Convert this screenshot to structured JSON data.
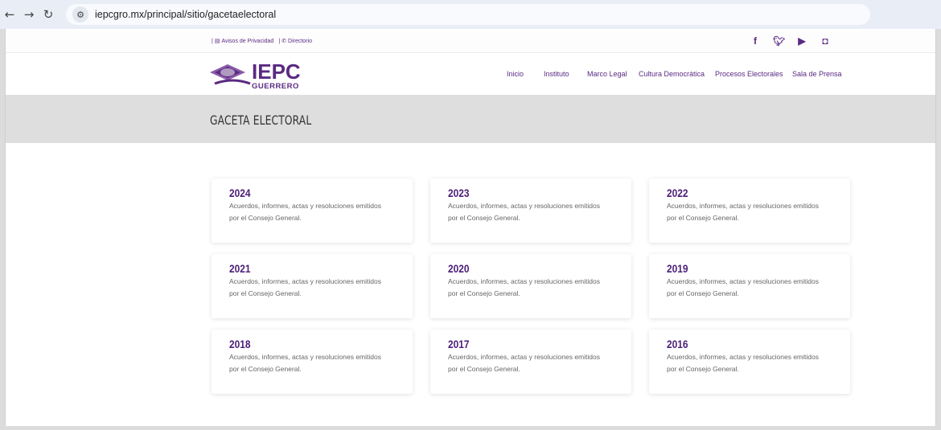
{
  "browser": {
    "url": "iepcgro.mx/principal/sitio/gacetaelectoral"
  },
  "utility": {
    "privacy": "Avisos de Privacidad",
    "directory": "Directorio"
  },
  "logo": {
    "title": "IEPC",
    "subtitle": "GUERRERO"
  },
  "menu": [
    "Inicio",
    "Instituto",
    "Marco Legal",
    "Cultura Democrática",
    "Procesos Electorales",
    "Sala de Prensa"
  ],
  "page": {
    "title": "GACETA ELECTORAL"
  },
  "cards": [
    {
      "year": "2024",
      "desc": "Acuerdos, informes, actas y resoluciones emitidos por el Consejo General."
    },
    {
      "year": "2023",
      "desc": "Acuerdos, informes, actas y resoluciones emitidos por el Consejo General."
    },
    {
      "year": "2022",
      "desc": "Acuerdos, informes, actas y resoluciones emitidos por el Consejo General."
    },
    {
      "year": "2021",
      "desc": "Acuerdos, informes, actas y resoluciones emitidos por el Consejo General."
    },
    {
      "year": "2020",
      "desc": "Acuerdos, informes, actas y resoluciones emitidos por el Consejo General."
    },
    {
      "year": "2019",
      "desc": "Acuerdos, informes, actas y resoluciones emitidos por el Consejo General."
    },
    {
      "year": "2018",
      "desc": "Acuerdos, informes, actas y resoluciones emitidos por el Consejo General."
    },
    {
      "year": "2017",
      "desc": "Acuerdos, informes, actas y resoluciones emitidos por el Consejo General."
    },
    {
      "year": "2016",
      "desc": "Acuerdos, informes, actas y resoluciones emitidos por el Consejo General."
    }
  ],
  "colors": {
    "brand": "#5a2a82",
    "band": "#dedede"
  }
}
